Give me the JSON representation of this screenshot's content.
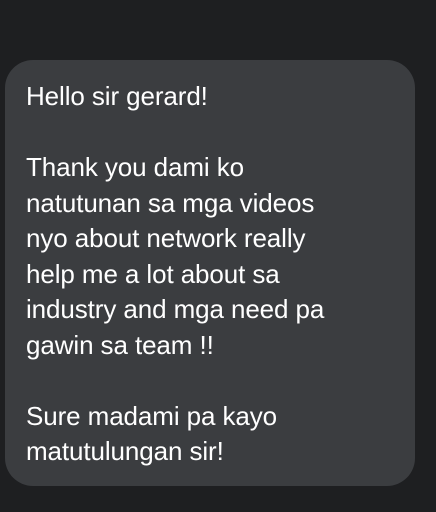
{
  "chat": {
    "message": {
      "greeting": "Hello sir gerard!",
      "body_lines": [
        "Thank you dami ko",
        "natutunan sa mga videos",
        "nyo about network really",
        "help me a lot about sa",
        "industry and mga need pa",
        "gawin sa team !!"
      ],
      "closing_lines": [
        "Sure madami pa kayo",
        "matutulungan sir!"
      ]
    }
  },
  "colors": {
    "background": "#1e1f21",
    "bubble": "#3b3d40",
    "text": "#ffffff"
  }
}
